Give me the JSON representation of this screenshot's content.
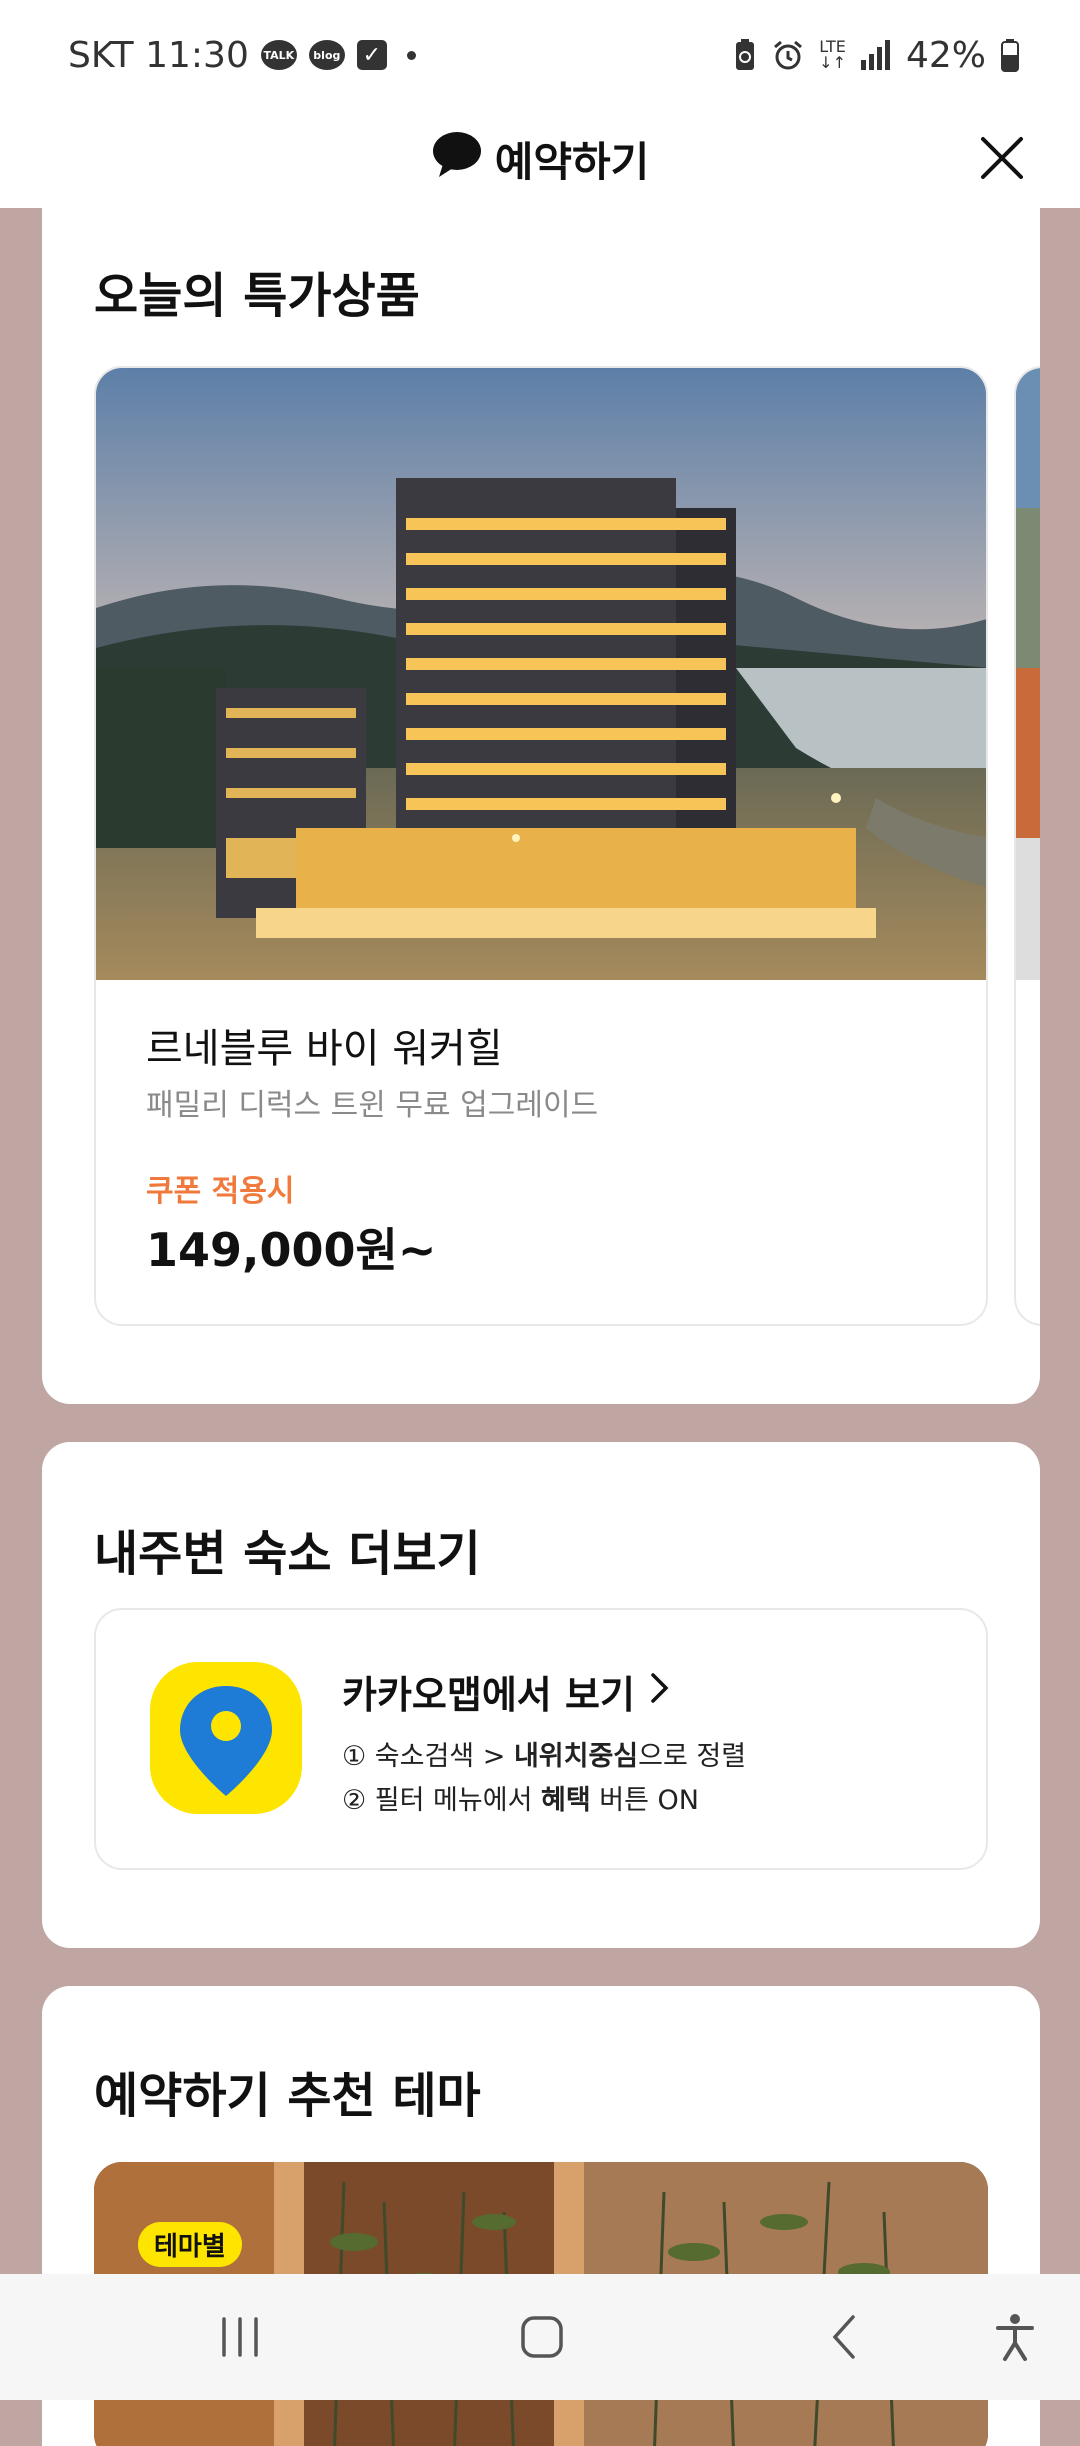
{
  "status_bar": {
    "carrier_time": "SKT 11:30",
    "talk_badge": "TALK",
    "blog_badge": "blog",
    "network": "LTE",
    "battery": "42%"
  },
  "header": {
    "title": "예약하기",
    "icons": [
      "chat-bubble-icon",
      "close-icon"
    ]
  },
  "deals": {
    "section_title": "오늘의 특가상품",
    "item": {
      "name": "르네블루 바이 워커힐",
      "description": "패밀리 디럭스 트윈 무료 업그레이드",
      "coupon_label": "쿠폰 적용시",
      "price": "149,000원~"
    }
  },
  "nearby": {
    "section_title": "내주변 숙소 더보기",
    "map_link": "카카오맵에서 보기",
    "line1": {
      "prefix": "① 숙소검색 > ",
      "bold": "내위치중심",
      "suffix": "으로 정렬"
    },
    "line2": {
      "prefix": "② 필터 메뉴에서 ",
      "bold": "혜택",
      "suffix": " 버튼 ON"
    }
  },
  "themes": {
    "section_title": "예약하기 추천 테마",
    "badge": "테마별"
  },
  "colors": {
    "background": "#bfa6a3",
    "coupon": "#ef7a3b",
    "kakao_yellow": "#fee500",
    "map_pin_blue": "#1e7bd6"
  }
}
